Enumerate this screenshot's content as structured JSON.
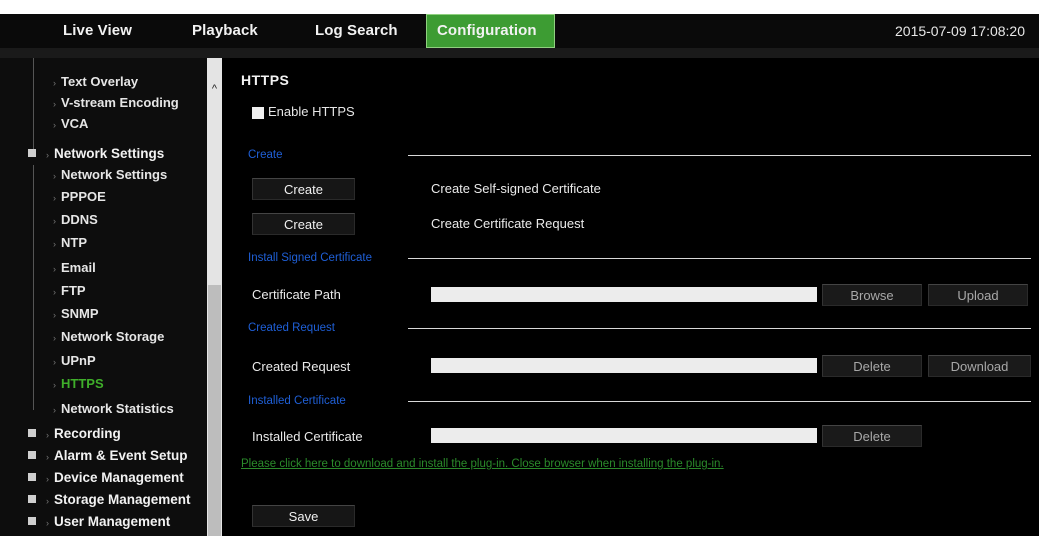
{
  "topbar": {
    "tabs": [
      "Live View",
      "Playback",
      "Log Search",
      "Configuration"
    ],
    "active_tab": "Configuration",
    "datetime": "2015-07-09 17:08:20",
    "active_color": "#3d9c33"
  },
  "sidebar": {
    "video_items": [
      "Text Overlay",
      "V-stream Encoding",
      "VCA"
    ],
    "network_group": "Network Settings",
    "network_items": [
      "Network Settings",
      "PPPOE",
      "DDNS",
      "NTP",
      "Email",
      "FTP",
      "SNMP",
      "Network Storage",
      "UPnP",
      "HTTPS",
      "Network Statistics"
    ],
    "active_item": "HTTPS",
    "groups": [
      "Recording",
      "Alarm & Event Setup",
      "Device Management",
      "Storage Management",
      "User Management"
    ]
  },
  "main": {
    "title": "HTTPS",
    "enable_label": "Enable  HTTPS",
    "enable_checked": false,
    "sections": {
      "create": "Create",
      "install": "Install Signed Certificate",
      "created_request": "Created Request",
      "installed": "Installed Certificate"
    },
    "create_button": "Create",
    "create_self_signed": "Create Self-signed Certificate",
    "create_request": "Create Certificate Request",
    "certificate_path_label": "Certificate Path",
    "certificate_path_value": "",
    "browse_button": "Browse",
    "upload_button": "Upload",
    "created_request_label": "Created Request",
    "created_request_value": "",
    "delete_button": "Delete",
    "download_button": "Download",
    "installed_certificate_label": "Installed Certificate",
    "installed_certificate_value": "",
    "plugin_link": "Please click here to download and install the plug-in. Close browser when installing the plug-in.",
    "save_button": "Save"
  }
}
